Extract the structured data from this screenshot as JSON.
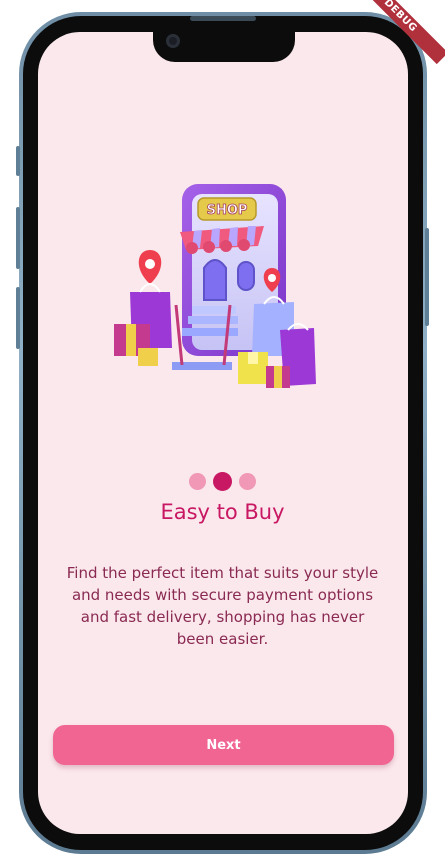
{
  "debug_banner": {
    "label": "DEBUG"
  },
  "illustration": {
    "sign_text": "SHOP"
  },
  "pager": {
    "total": 3,
    "active_index": 1
  },
  "onboarding": {
    "title": "Easy to Buy",
    "description": "Find the perfect item that suits your style and needs with secure payment options and fast delivery, shopping has never been easier."
  },
  "actions": {
    "next_label": "Next"
  },
  "colors": {
    "background": "#fbe8ec",
    "accent": "#c81763",
    "dot_inactive": "#f098b5",
    "button": "#f06592",
    "text": "#8a2a52"
  }
}
